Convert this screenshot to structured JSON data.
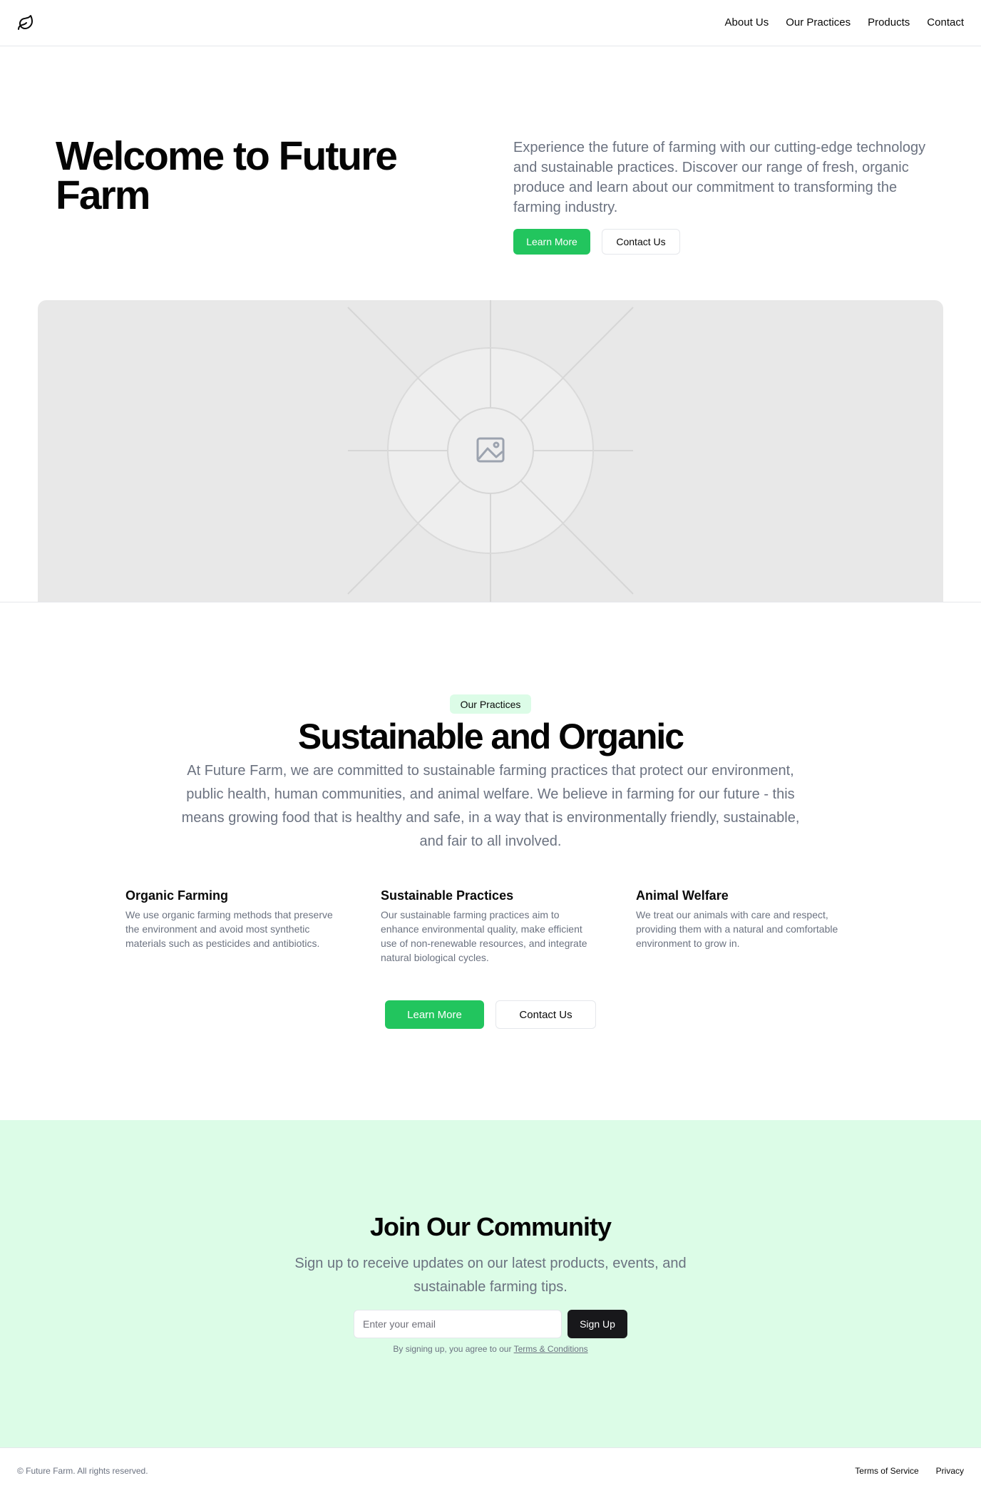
{
  "header": {
    "logo_icon": "leaf-icon",
    "nav": [
      {
        "label": "About Us"
      },
      {
        "label": "Our Practices"
      },
      {
        "label": "Products"
      },
      {
        "label": "Contact"
      }
    ]
  },
  "hero": {
    "title": "Welcome to Future Farm",
    "description": "Experience the future of farming with our cutting-edge technology and sustainable practices. Discover our range of fresh, organic produce and learn about our commitment to transforming the farming industry.",
    "primary_button": "Learn More",
    "secondary_button": "Contact Us",
    "image_icon": "image-placeholder-icon"
  },
  "practices": {
    "badge": "Our Practices",
    "title": "Sustainable and Organic",
    "description": "At Future Farm, we are committed to sustainable farming practices that protect our environment, public health, human communities, and animal welfare. We believe in farming for our future - this means growing food that is healthy and safe, in a way that is environmentally friendly, sustainable, and fair to all involved.",
    "features": [
      {
        "title": "Organic Farming",
        "text": "We use organic farming methods that preserve the environment and avoid most synthetic materials such as pesticides and antibiotics."
      },
      {
        "title": "Sustainable Practices",
        "text": "Our sustainable farming practices aim to enhance environmental quality, make efficient use of non-renewable resources, and integrate natural biological cycles."
      },
      {
        "title": "Animal Welfare",
        "text": "We treat our animals with care and respect, providing them with a natural and comfortable environment to grow in."
      }
    ],
    "primary_button": "Learn More",
    "secondary_button": "Contact Us"
  },
  "community": {
    "title": "Join Our Community",
    "description": "Sign up to receive updates on our latest products, events, and sustainable farming tips.",
    "email_placeholder": "Enter your email",
    "email_value": "",
    "signup_button": "Sign Up",
    "terms_prefix": "By signing up, you agree to our ",
    "terms_link": "Terms & Conditions"
  },
  "footer": {
    "copyright": "© Future Farm. All rights reserved.",
    "links": [
      {
        "label": "Terms of Service"
      },
      {
        "label": "Privacy"
      }
    ]
  },
  "colors": {
    "accent": "#22c55e",
    "accent_light": "#dcfce7",
    "text_muted": "#6b7280",
    "dark_button": "#18181b",
    "placeholder_bg": "#e8e8e8"
  }
}
